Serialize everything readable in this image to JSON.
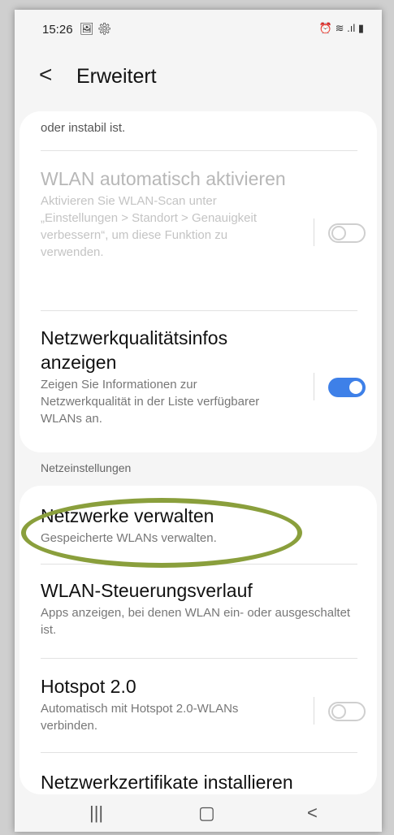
{
  "status_bar": {
    "time": "15:26",
    "left_icons": "🖼 ⚙",
    "right_icons": "⏰ ≋ .ıl ▮"
  },
  "header": {
    "back_icon": "<",
    "title": "Erweitert"
  },
  "card1": {
    "truncated_text": "oder instabil ist.",
    "wlan_auto": {
      "title": "WLAN automatisch aktivieren",
      "subtitle": "Aktivieren Sie WLAN-Scan unter „Einstellungen > Standort > Genauigkeit verbessern“, um diese Funktion zu verwenden.",
      "toggle_state": "off",
      "disabled": true
    },
    "quality_info": {
      "title": "Netzwerkqualitätsinfos anzeigen",
      "subtitle": "Zeigen Sie Informationen zur Netzwerkqualität in der Liste verfügbarer WLANs an.",
      "toggle_state": "on"
    }
  },
  "section_label": "Netzeinstellungen",
  "card2": {
    "manage": {
      "title": "Netzwerke verwalten",
      "subtitle": "Gespeicherte WLANs verwalten."
    },
    "history": {
      "title": "WLAN-Steuerungsverlauf",
      "subtitle": "Apps anzeigen, bei denen WLAN ein- oder ausgeschaltet ist."
    },
    "hotspot": {
      "title": "Hotspot 2.0",
      "subtitle": "Automatisch mit Hotspot 2.0-WLANs verbinden.",
      "toggle_state": "off"
    },
    "certs": {
      "title": "Netzwerkzertifikate installieren"
    }
  },
  "nav_bar": {
    "recents_icon": "|||",
    "home_icon": "▢",
    "back_icon": "<"
  },
  "colors": {
    "accent": "#3e80e8",
    "highlight_ring": "#8a9f3c"
  }
}
